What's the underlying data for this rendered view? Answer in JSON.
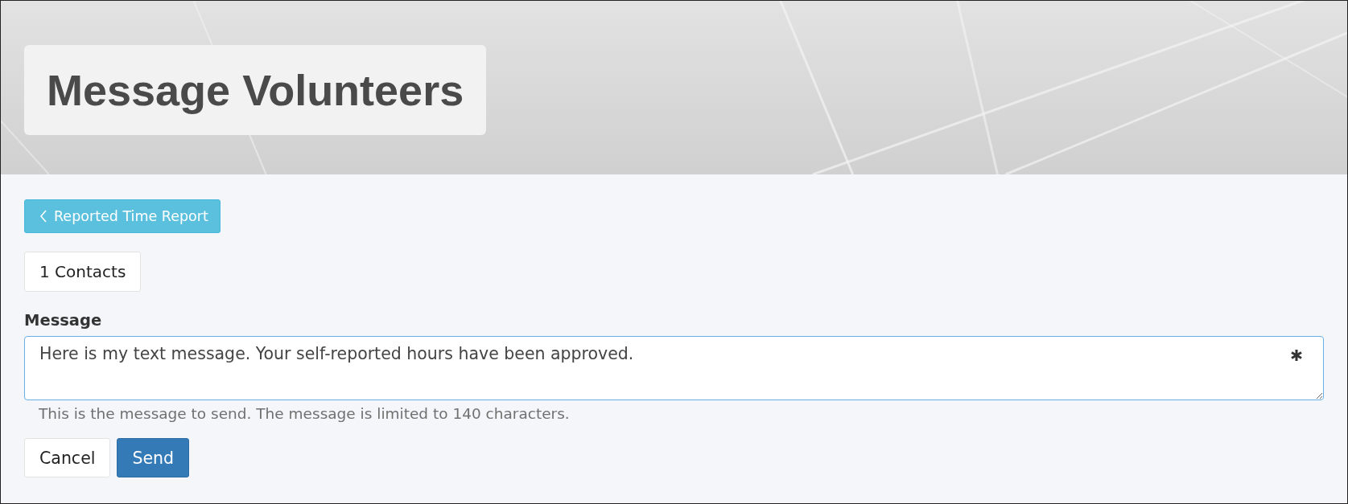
{
  "header": {
    "title": "Message Volunteers"
  },
  "back_button": {
    "label": "Reported Time Report"
  },
  "contacts": {
    "label": "1 Contacts"
  },
  "message_field": {
    "label": "Message",
    "value": "Here is my text message. Your self-reported hours have been approved.",
    "required": true,
    "help": "This is the message to send. The message is limited to 140 characters."
  },
  "buttons": [
    {
      "label": "Cancel",
      "kind": "default"
    },
    {
      "label": "Send",
      "kind": "primary"
    }
  ]
}
